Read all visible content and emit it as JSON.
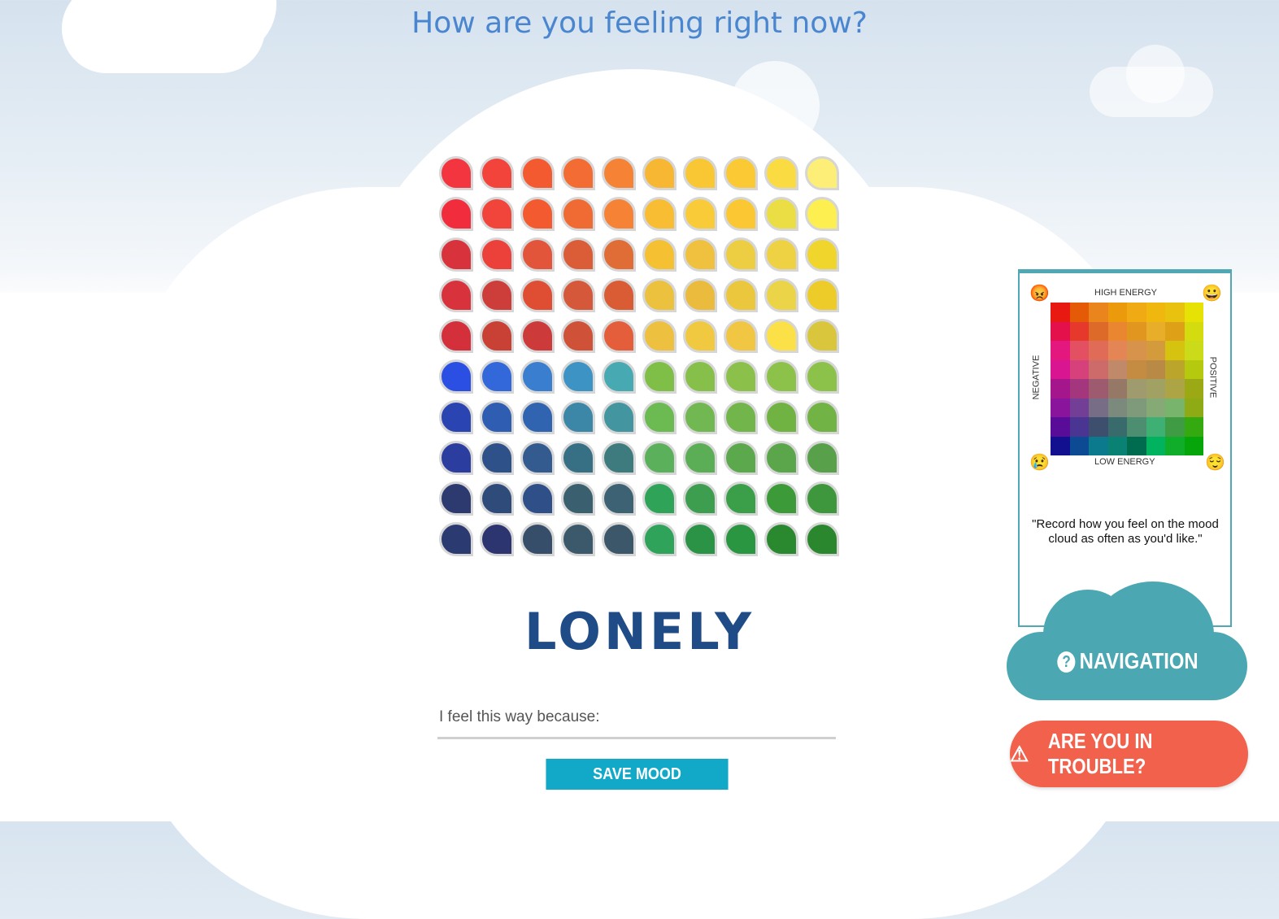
{
  "header": {
    "title": "How are you feeling right now?"
  },
  "mood_grid": {
    "rows": [
      [
        "#f2353f",
        "#f2443a",
        "#f45a30",
        "#f36c34",
        "#f68335",
        "#f8b733",
        "#f9c734",
        "#fac933",
        "#fadc42",
        "#fcee76"
      ],
      [
        "#f12d3d",
        "#f1443a",
        "#f45a30",
        "#ef6b33",
        "#f68235",
        "#f8bd33",
        "#f9cb38",
        "#fbc833",
        "#ebde44",
        "#fdef4f"
      ],
      [
        "#d8333c",
        "#ec403a",
        "#e3553a",
        "#da5d38",
        "#e06d36",
        "#f6c033",
        "#f0c13f",
        "#edcd42",
        "#efd144",
        "#f0d52c"
      ],
      [
        "#d8333c",
        "#cd3e3a",
        "#df4e32",
        "#d6583a",
        "#d95c35",
        "#ebc13d",
        "#ebbb3e",
        "#ebc73d",
        "#ebd447",
        "#edcc2a"
      ],
      [
        "#d3303b",
        "#c94034",
        "#cc3b3a",
        "#cf5137",
        "#e45e3b",
        "#edc13f",
        "#f1c941",
        "#f1c642",
        "#fbe047",
        "#d9c63c"
      ],
      [
        "#2b4ee3",
        "#3368db",
        "#3a7ecf",
        "#3d93c4",
        "#47a9b2",
        "#7fbf48",
        "#86c04a",
        "#8bc14a",
        "#8cc24a",
        "#8cc24a"
      ],
      [
        "#2a44b2",
        "#2e5db1",
        "#3164b0",
        "#3c87a7",
        "#4395a0",
        "#6bba52",
        "#72b852",
        "#72b54b",
        "#71b343",
        "#71b344"
      ],
      [
        "#2b3e9f",
        "#2f5189",
        "#335b8f",
        "#376f85",
        "#3d7b7f",
        "#5bb05b",
        "#5bae56",
        "#5ba94c",
        "#5ba64b",
        "#58a049"
      ],
      [
        "#2c3a70",
        "#2f4b7a",
        "#2f4f88",
        "#3a5f6f",
        "#3d6274",
        "#2fa458",
        "#3d9e4f",
        "#3a9f48",
        "#3c9a39",
        "#3f973d"
      ],
      [
        "#2c3a72",
        "#2c3570",
        "#374e6a",
        "#3b596b",
        "#3b5769",
        "#2fa35a",
        "#2a9346",
        "#2b9642",
        "#2a882e",
        "#2b872e"
      ]
    ]
  },
  "selected_mood": "LONELY",
  "reason_field": {
    "placeholder": "I feel this way because:",
    "value": ""
  },
  "save_button": {
    "label": "SAVE MOOD",
    "color": "#12a9c9"
  },
  "info_card": {
    "top_label": "HIGH ENERGY",
    "bottom_label": "LOW ENERGY",
    "left_label": "NEGATIVE",
    "right_label": "POSITIVE",
    "quote": "\"Record how you feel on the mood cloud as often as you'd like.\"",
    "mini_rows": [
      [
        "#e81910",
        "#e55a06",
        "#e9851c",
        "#eb9a0c",
        "#efaa14",
        "#f0b80f",
        "#e9c10f",
        "#e6e205"
      ],
      [
        "#e3104c",
        "#e6392c",
        "#de6a2a",
        "#ea8530",
        "#e0961f",
        "#e9ae29",
        "#dda016",
        "#d4dc10"
      ],
      [
        "#e4177e",
        "#e35061",
        "#e06c57",
        "#e48556",
        "#d7924b",
        "#d49b3c",
        "#d5c30f",
        "#cbdb1a"
      ],
      [
        "#da1591",
        "#d6417c",
        "#cd6a6a",
        "#c0896a",
        "#c48c42",
        "#b98a45",
        "#bca52b",
        "#b5c90f"
      ],
      [
        "#a5168c",
        "#a4367e",
        "#9e5a6e",
        "#967867",
        "#a09a6f",
        "#a0a163",
        "#aca445",
        "#9aa914"
      ],
      [
        "#8a149b",
        "#733f96",
        "#776d86",
        "#7b8a7c",
        "#7f9a7b",
        "#86aa75",
        "#78b46c",
        "#8eaa14"
      ],
      [
        "#580c97",
        "#4a3593",
        "#3e4f6e",
        "#396a6c",
        "#4d8e70",
        "#3fb073",
        "#3f9c44",
        "#35aa10"
      ],
      [
        "#12108f",
        "#0c4b94",
        "#0b7a8c",
        "#098273",
        "#006c4f",
        "#01b25e",
        "#10ad2a",
        "#06a60b"
      ]
    ]
  },
  "nav_button": {
    "label": "NAVIGATION",
    "color": "#4ba8b2"
  },
  "trouble_button": {
    "label": "ARE YOU IN TROUBLE?",
    "color": "#f2614c"
  }
}
